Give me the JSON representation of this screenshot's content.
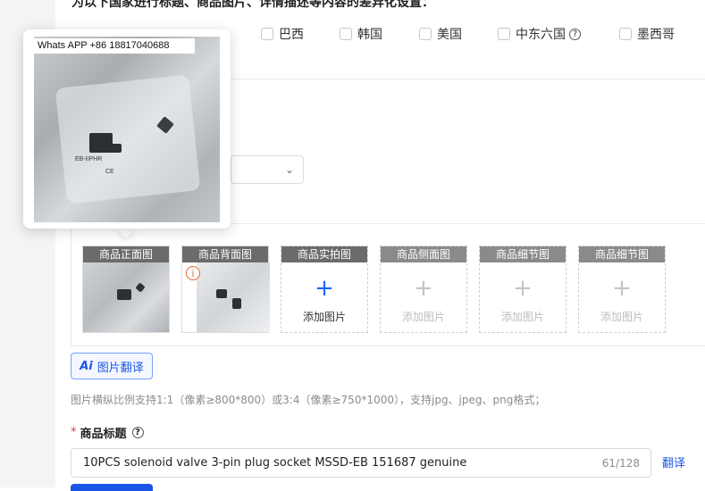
{
  "heading": "为以下国家进行标题、商品图片、详情描述等内容的差异化设置：",
  "countries": [
    {
      "label": "巴西"
    },
    {
      "label": "韩国"
    },
    {
      "label": "美国"
    },
    {
      "label": "中东六国",
      "help_icon": "question-circle-icon"
    },
    {
      "label": "墨西哥"
    }
  ],
  "popover": {
    "watermark_text": "Whats APP +86 18817040688",
    "bag_label_1": "EB-IIPHR",
    "bag_label_2": "CE"
  },
  "image_slots": [
    {
      "title": "商品正面图",
      "state": "filled"
    },
    {
      "title": "商品背面图",
      "state": "filled",
      "warning_icon": "info-warning-icon"
    },
    {
      "title": "商品实拍图",
      "state": "empty_active",
      "add_label": "添加图片"
    },
    {
      "title": "商品侧面图",
      "state": "empty_disabled",
      "add_label": "添加图片"
    },
    {
      "title": "商品细节图",
      "state": "empty_disabled",
      "add_label": "添加图片"
    },
    {
      "title": "商品细节图",
      "state": "empty_disabled",
      "add_label": "添加图片"
    }
  ],
  "image_translate_button": {
    "ai_mark": "Ai",
    "label": "图片翻译"
  },
  "image_hint": "图片横纵比例支持1:1（像素≥800*800）或3:4（像素≥750*1000），支持jpg、jpeg、png格式；",
  "product_title": {
    "required_mark": "*",
    "label": "商品标题",
    "help_icon": "question-circle-icon",
    "value": "10PCS solenoid valve 3-pin plug socket MSSD-EB 151687 genuine",
    "counter": "61/128",
    "translate_link": "翻译"
  },
  "colors": {
    "accent": "#1a55e6",
    "warning": "#e6692c",
    "required": "#e23d3d"
  }
}
